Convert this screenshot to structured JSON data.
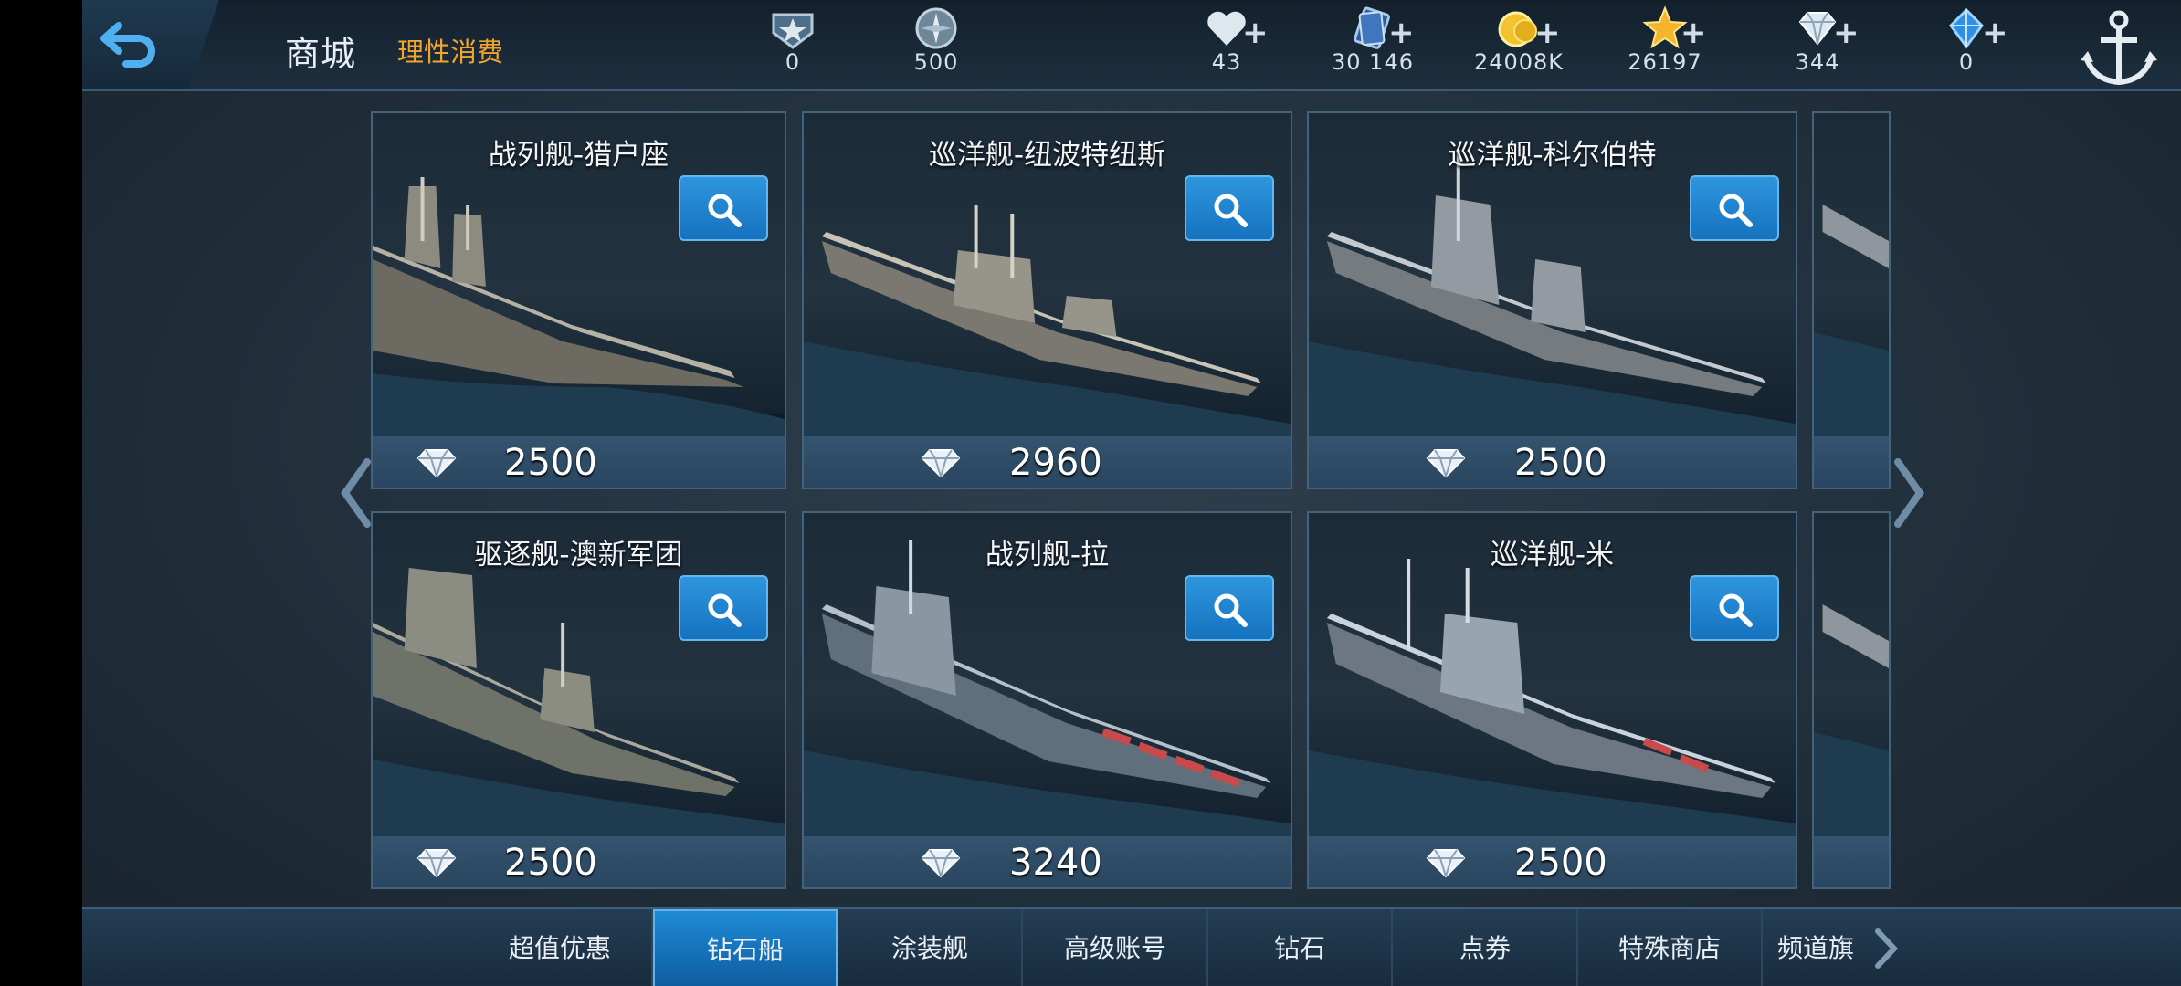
{
  "header": {
    "title": "商城",
    "slogan": "理性消费"
  },
  "resources": [
    {
      "name": "rank-badge-icon",
      "value": "0",
      "plus": ""
    },
    {
      "name": "compass-token-icon",
      "value": "500",
      "plus": ""
    },
    {
      "name": "heart-icon",
      "value": "43",
      "plus": "+"
    },
    {
      "name": "card-icon",
      "value": "30 146",
      "plus": "+"
    },
    {
      "name": "gold-coin-icon",
      "value": "24008K",
      "plus": "+"
    },
    {
      "name": "star-icon",
      "value": "26197",
      "plus": "+"
    },
    {
      "name": "diamond-icon",
      "value": "344",
      "plus": "+"
    },
    {
      "name": "blue-crystal-icon",
      "value": "0",
      "plus": "+"
    }
  ],
  "ships": [
    {
      "name": "战列舰-猎户座",
      "price": "2500"
    },
    {
      "name": "巡洋舰-纽波特纽斯",
      "price": "2960"
    },
    {
      "name": "巡洋舰-科尔伯特",
      "price": "2500"
    },
    {
      "name": "驱逐舰-澳新军团",
      "price": "2500"
    },
    {
      "name": "战列舰-拉",
      "price": "3240"
    },
    {
      "name": "巡洋舰-米",
      "price": "2500"
    }
  ],
  "tabs": [
    {
      "label": "超值优惠",
      "active": false
    },
    {
      "label": "钻石船",
      "active": true
    },
    {
      "label": "涂装舰",
      "active": false
    },
    {
      "label": "高级账号",
      "active": false
    },
    {
      "label": "钻石",
      "active": false
    },
    {
      "label": "点券",
      "active": false
    },
    {
      "label": "特殊商店",
      "active": false
    },
    {
      "label": "频道旗",
      "active": false
    }
  ],
  "colors": {
    "accent": "#1e8ad6",
    "slogan": "#f0a52c",
    "panel": "#1b2a37"
  }
}
